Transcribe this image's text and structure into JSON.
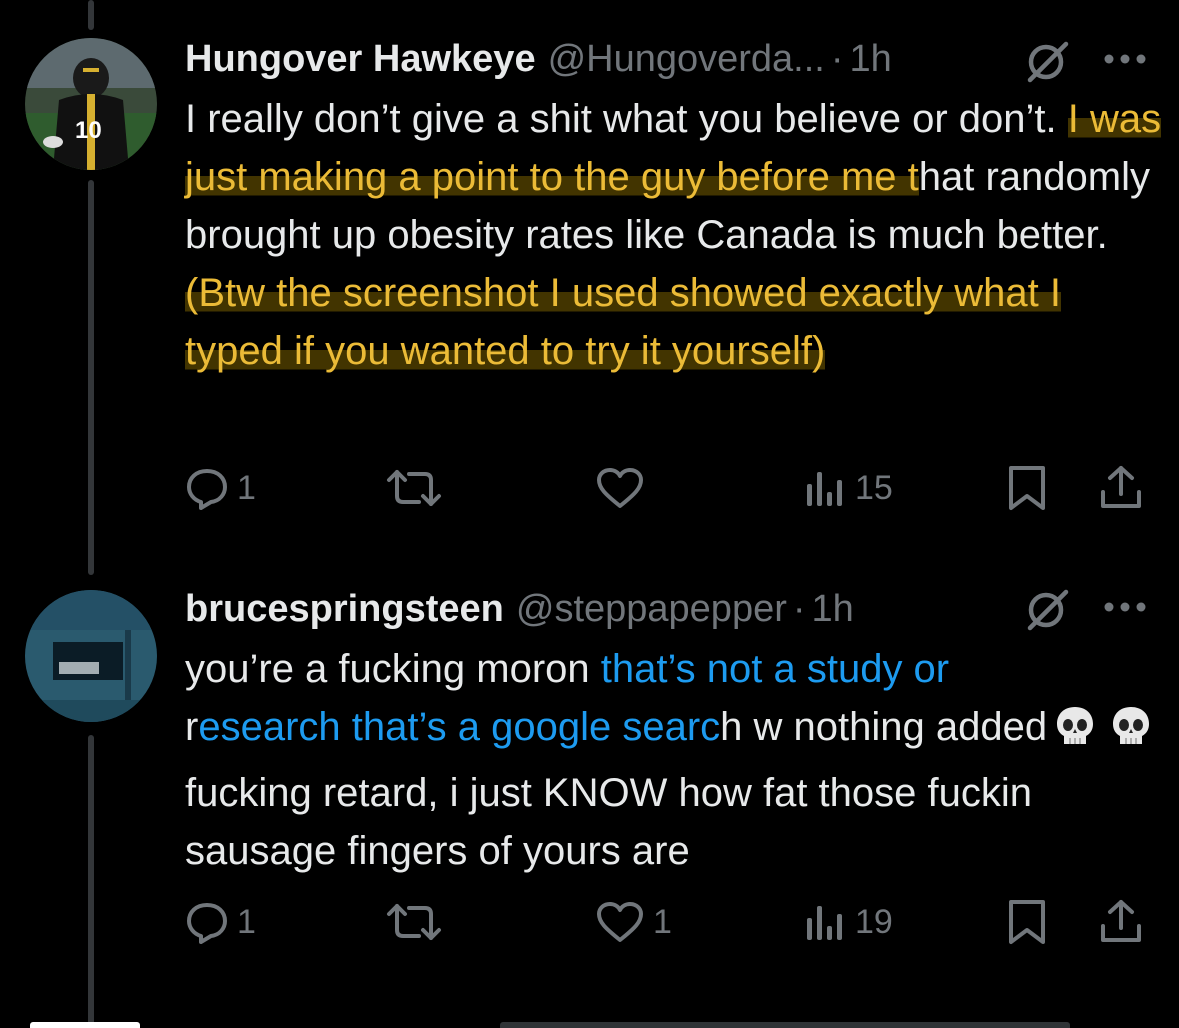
{
  "tweets": [
    {
      "name": "Hungover Hawkeye",
      "handle": "@Hungoverda...",
      "separator": "·",
      "time": "1h",
      "avatar_number": "10",
      "text": {
        "part1": "I really don’t give a shit what you believe or don’t. ",
        "highlight1": "I was just making a point to the guy before me t",
        "part2": "hat randomly brought up obesity rates like Canada is much better. ",
        "highlight2": "(Btw the screenshot I used showed exactly what I typed if you wanted to try it yourself)"
      },
      "actions": {
        "replies": "1",
        "reposts": "",
        "likes": "",
        "views": "15"
      }
    },
    {
      "name": "brucespringsteen",
      "handle": "@steppapepper",
      "separator": "·",
      "time": "1h",
      "text": {
        "part1": "you’re a fucking moron ",
        "link1": "that’s not a study or",
        "part2": "r",
        "link2": "esearch that’s a google searc",
        "part3": "h w nothing added",
        "part4": "fucking retard, i just KNOW how fat those fuckin sausage fingers of yours are"
      },
      "emoji": "💀",
      "actions": {
        "replies": "1",
        "reposts": "",
        "likes": "1",
        "views": "19"
      }
    }
  ],
  "colors": {
    "background": "#000000",
    "text": "#e7e9ea",
    "muted": "#71767b",
    "highlight": "#ebbb37",
    "link": "#1d9bf0"
  },
  "icons": [
    "reply-icon",
    "repost-icon",
    "like-icon",
    "views-icon",
    "bookmark-icon",
    "share-icon",
    "grok-icon",
    "more-icon",
    "skull-emoji"
  ]
}
